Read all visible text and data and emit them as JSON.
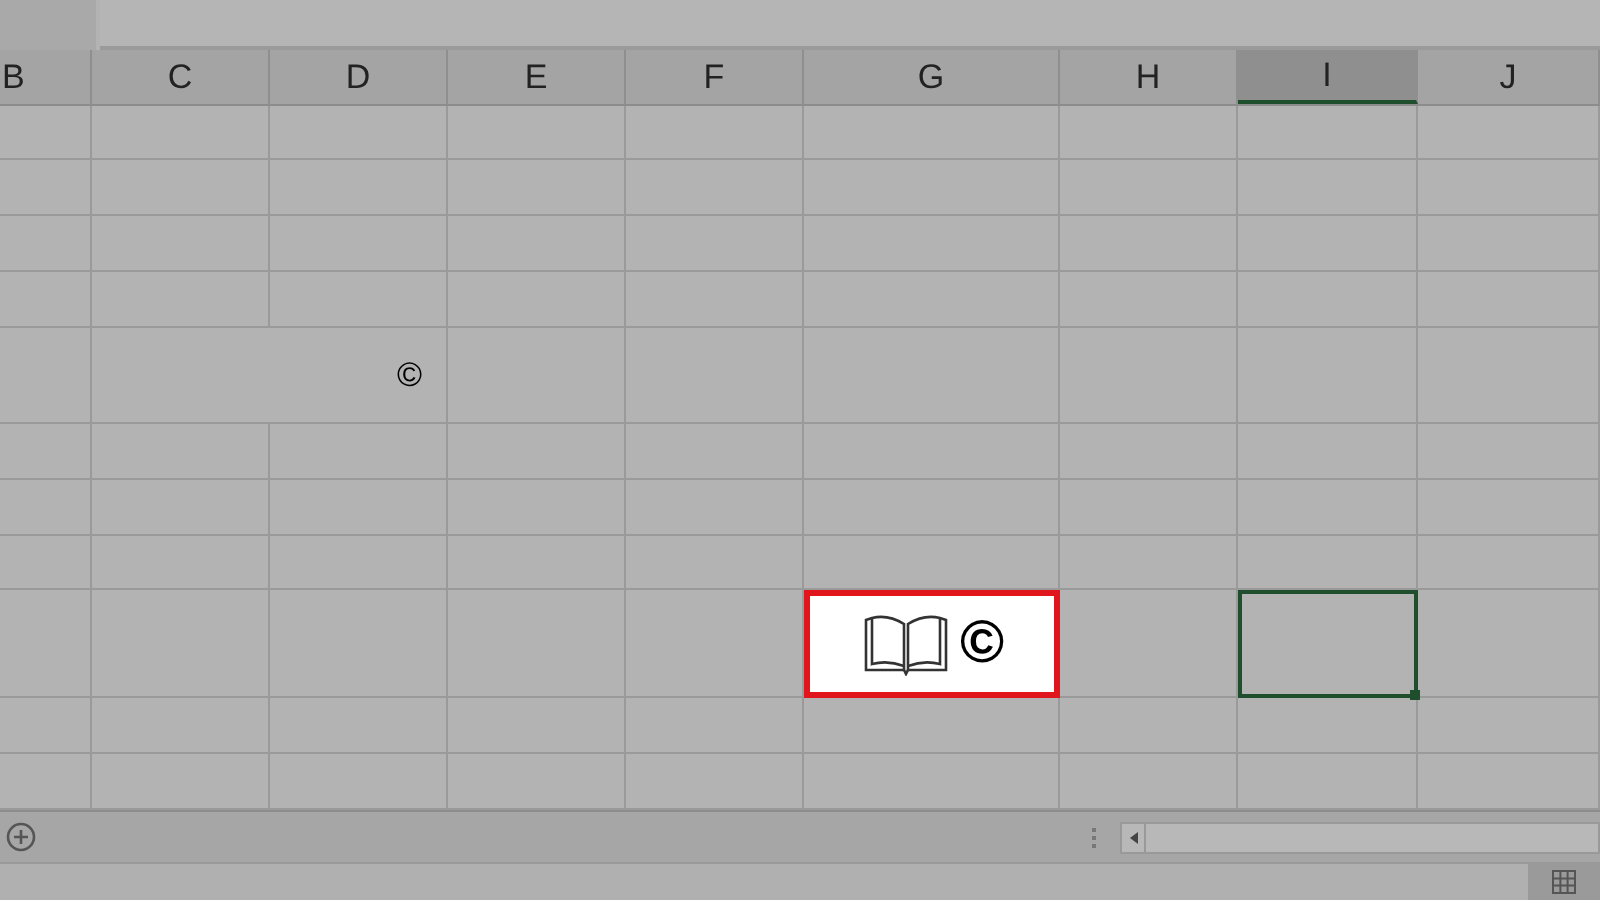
{
  "columns": [
    {
      "label": "B",
      "selected": false
    },
    {
      "label": "C",
      "selected": false
    },
    {
      "label": "D",
      "selected": false
    },
    {
      "label": "E",
      "selected": false
    },
    {
      "label": "F",
      "selected": false
    },
    {
      "label": "G",
      "selected": false
    },
    {
      "label": "H",
      "selected": false
    },
    {
      "label": "I",
      "selected": true
    },
    {
      "label": "J",
      "selected": false
    }
  ],
  "merged_cell": {
    "text": "©"
  },
  "highlighted_cell": {
    "text": "©"
  }
}
